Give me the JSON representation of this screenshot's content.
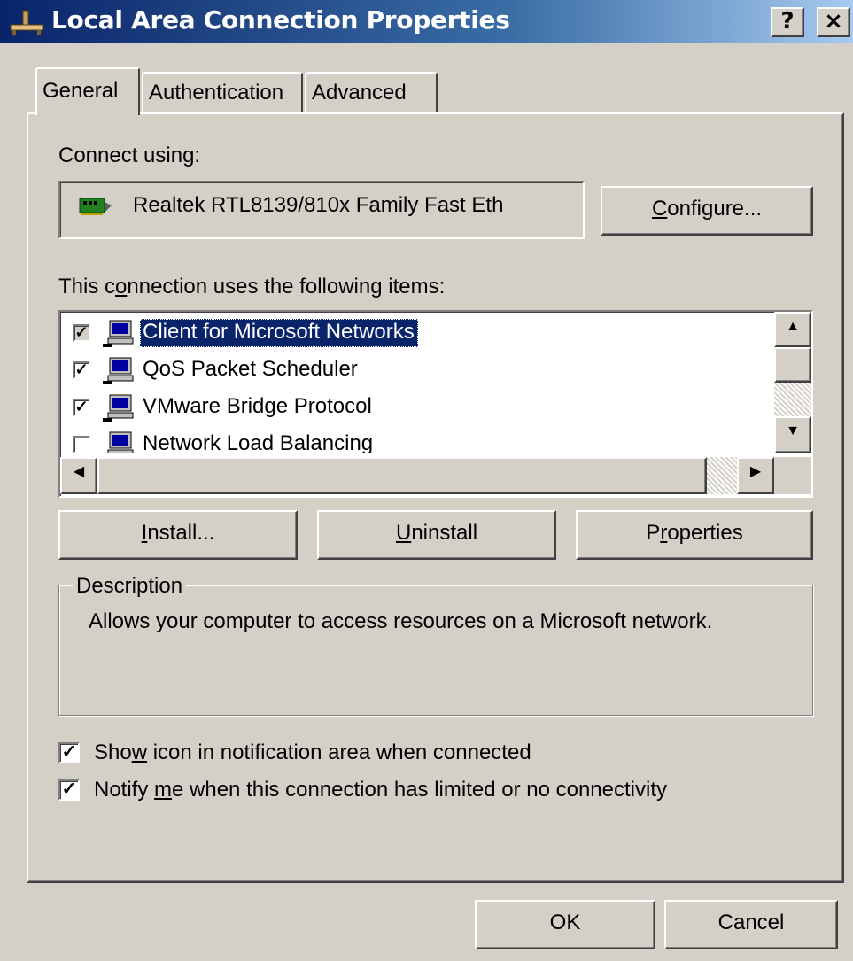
{
  "window": {
    "title": "Local Area Connection Properties",
    "help_label": "?",
    "close_label": "×"
  },
  "tabs": [
    {
      "label": "General",
      "active": true
    },
    {
      "label": "Authentication",
      "active": false
    },
    {
      "label": "Advanced",
      "active": false
    }
  ],
  "connect_using": {
    "label": "Connect using:",
    "adapter": "Realtek RTL8139/810x Family Fast Eth",
    "configure_pre": "",
    "configure_u": "C",
    "configure_post": "onfigure..."
  },
  "items_section": {
    "label_pre": "This c",
    "label_u": "o",
    "label_post": "nnection uses the following items:",
    "items": [
      {
        "label": "Client for Microsoft Networks",
        "checked": true,
        "selected": true
      },
      {
        "label": "QoS Packet Scheduler",
        "checked": true,
        "selected": false
      },
      {
        "label": "VMware Bridge Protocol",
        "checked": true,
        "selected": false
      },
      {
        "label": "Network Load Balancing",
        "checked": false,
        "selected": false
      }
    ]
  },
  "buttons": {
    "install": {
      "pre": "",
      "u": "I",
      "post": "nstall..."
    },
    "uninstall": {
      "pre": "",
      "u": "U",
      "post": "ninstall"
    },
    "properties": {
      "pre": "P",
      "u": "r",
      "post": "operties"
    }
  },
  "description": {
    "title": "Description",
    "text": "Allows your computer to access resources on a Microsoft network."
  },
  "options": {
    "show_icon": {
      "pre": "Sho",
      "u": "w",
      "post": " icon in notification area when connected",
      "checked": true
    },
    "notify": {
      "pre": "Notify ",
      "u": "m",
      "post": "e when this connection has limited or no connectivity",
      "checked": true
    }
  },
  "footer": {
    "ok": "OK",
    "cancel": "Cancel"
  }
}
